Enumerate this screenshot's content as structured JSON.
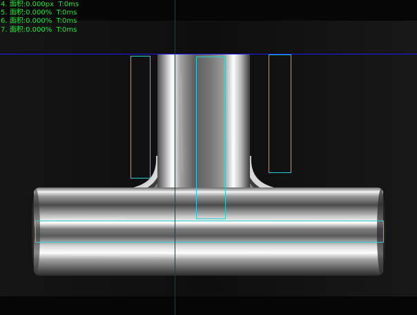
{
  "readouts": [
    {
      "index": "4.",
      "label": "面积:",
      "value": "0.000px",
      "time": "T:0ms"
    },
    {
      "index": "5.",
      "label": "面积:",
      "value": "0.000%",
      "time": "T:0ms"
    },
    {
      "index": "6.",
      "label": "面积:",
      "value": "0.000%",
      "time": "T:0ms"
    },
    {
      "index": "7.",
      "label": "面积:",
      "value": "0.000%",
      "time": "T:0ms"
    }
  ],
  "colors": {
    "roi": "#22d3d6",
    "crosshair": "#1a1aff",
    "readout_text": "#22e83a",
    "background": "#050505"
  },
  "image": {
    "subject": "metal-t-pipe-fitting-grayscale"
  },
  "icons": {
    "crosshair": "crosshair-icon"
  }
}
